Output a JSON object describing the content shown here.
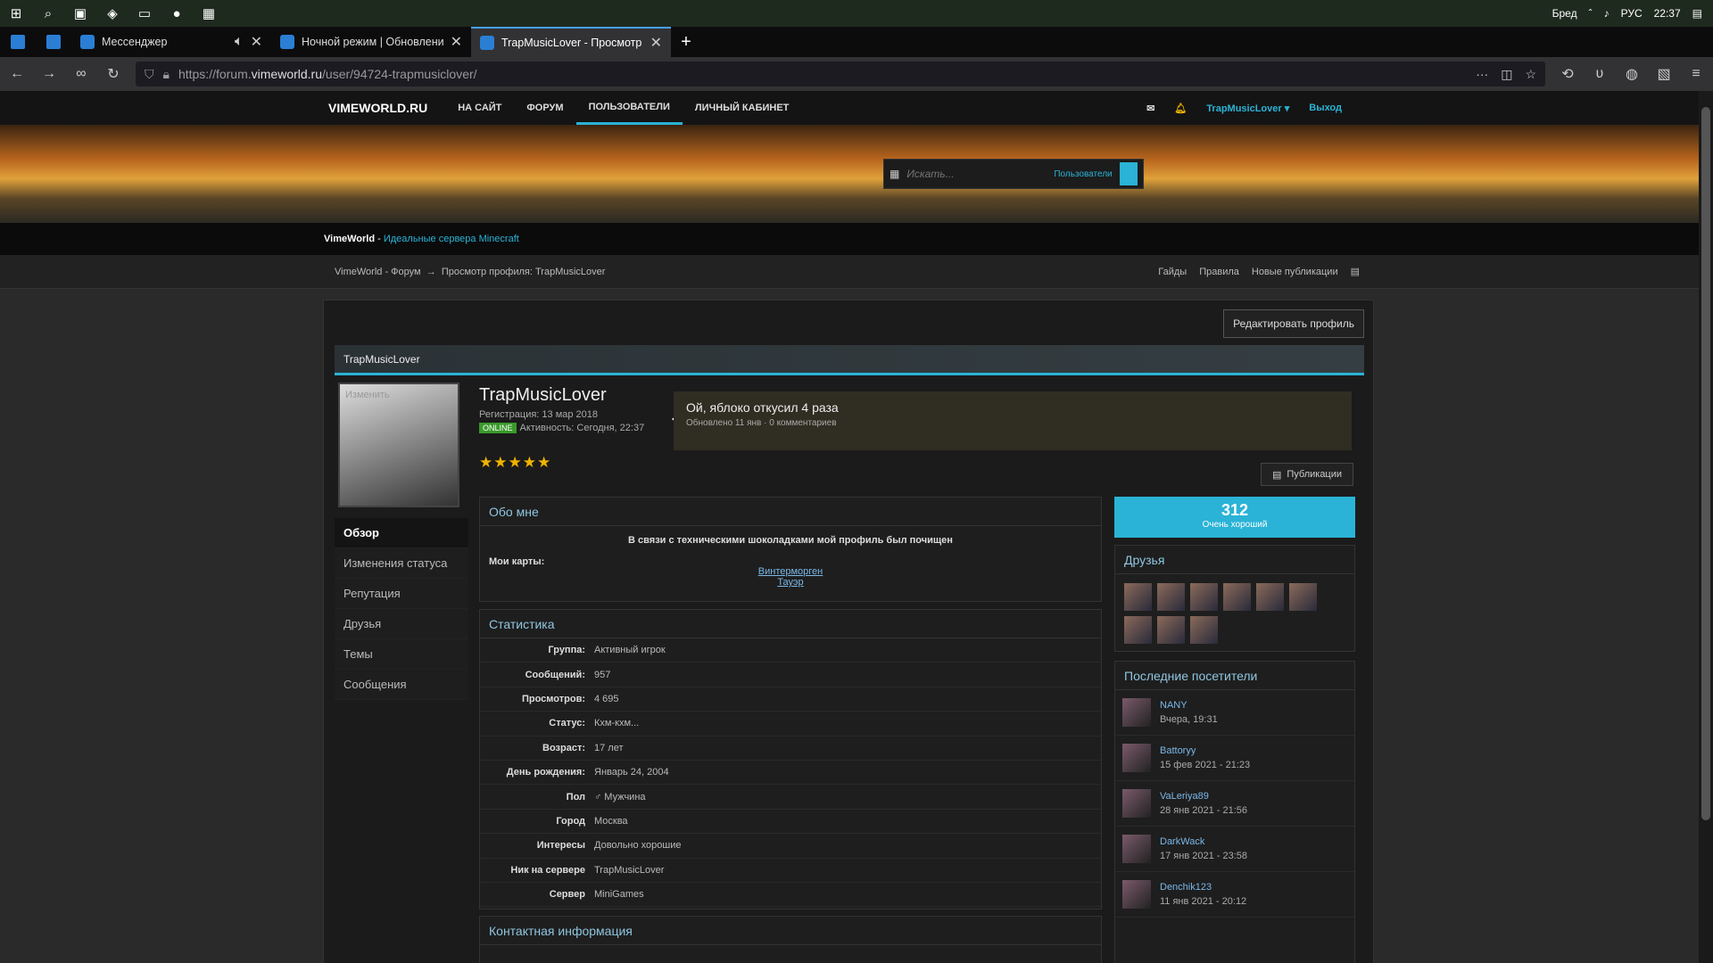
{
  "taskbar": {
    "user": "Бред",
    "lang": "РУС",
    "time": "22:37"
  },
  "tabs": [
    {
      "title": "Мессенджер",
      "active": false
    },
    {
      "title": "Ночной режим | Обновления",
      "active": false
    },
    {
      "title": "TrapMusicLover - Просмотр п",
      "active": true
    }
  ],
  "address": {
    "prefix": "https://forum.",
    "domain": "vimeworld.ru",
    "path": "/user/94724-trapmusiclover/"
  },
  "site": {
    "logo": "VIMEWORLD.RU",
    "menu": [
      "НА САЙТ",
      "ФОРУМ",
      "ПОЛЬЗОВАТЕЛИ",
      "ЛИЧНЫЙ КАБИНЕТ"
    ],
    "username": "TrapMusicLover",
    "logout": "Выход",
    "search_placeholder": "Искать...",
    "search_scope": "Пользователи",
    "subtitle_brand": "VimeWorld",
    "subtitle_sep": " - ",
    "subtitle_text": "Идеальные сервера Minecraft",
    "breadcrumb": [
      "VimeWorld - Форум",
      "→",
      "Просмотр профиля: TrapMusicLover"
    ],
    "links": [
      "Гайды",
      "Правила",
      "Новые публикации"
    ]
  },
  "profile": {
    "edit": "Редактировать профиль",
    "header": "TrapMusicLover",
    "avatar_change": "Изменить",
    "name": "TrapMusicLover",
    "registered": "Регистрация: 13 мар 2018",
    "online": "ONLINE",
    "activity": "Активность: Сегодня, 22:37",
    "stars": "★★★★★",
    "status": "Ой, яблоко откусил 4 раза",
    "status_meta": "Обновлено 11 янв · 0 комментариев",
    "pubs": "Публикации",
    "menu": [
      "Обзор",
      "Изменения статуса",
      "Репутация",
      "Друзья",
      "Темы",
      "Сообщения"
    ],
    "about_title": "Обо мне",
    "about_text": "В связи с техническими шоколадками мой профиль был почищен",
    "maps_label": "Мои карты:",
    "maps": [
      "Винтерморген",
      "Тауэр"
    ],
    "stats_title": "Статистика",
    "stats": [
      {
        "k": "Группа:",
        "v": "Активный игрок"
      },
      {
        "k": "Сообщений:",
        "v": "957"
      },
      {
        "k": "Просмотров:",
        "v": "4 695"
      },
      {
        "k": "Статус:",
        "v": "Кхм-кхм..."
      },
      {
        "k": "Возраст:",
        "v": "17 лет"
      },
      {
        "k": "День рождения:",
        "v": "Январь 24, 2004"
      },
      {
        "k": "Пол",
        "v": "♂ Мужчина"
      },
      {
        "k": "Город",
        "v": "Москва"
      },
      {
        "k": "Интересы",
        "v": "Довольно хорошие"
      },
      {
        "k": "Ник на сервере",
        "v": "TrapMusicLover"
      },
      {
        "k": "Сервер",
        "v": "MiniGames"
      }
    ],
    "contact_title": "Контактная информация",
    "rep_value": "312",
    "rep_label": "Очень хороший",
    "friends_title": "Друзья",
    "visitors_title": "Последние посетители",
    "visitors": [
      {
        "name": "NANY",
        "date": "Вчера, 19:31"
      },
      {
        "name": "Battoryy",
        "date": "15 фев 2021 - 21:23"
      },
      {
        "name": "VaLeriya89",
        "date": "28 янв 2021 - 21:56"
      },
      {
        "name": "DarkWack",
        "date": "17 янв 2021 - 23:58"
      },
      {
        "name": "Denchik123",
        "date": "11 янв 2021 - 20:12"
      }
    ]
  }
}
